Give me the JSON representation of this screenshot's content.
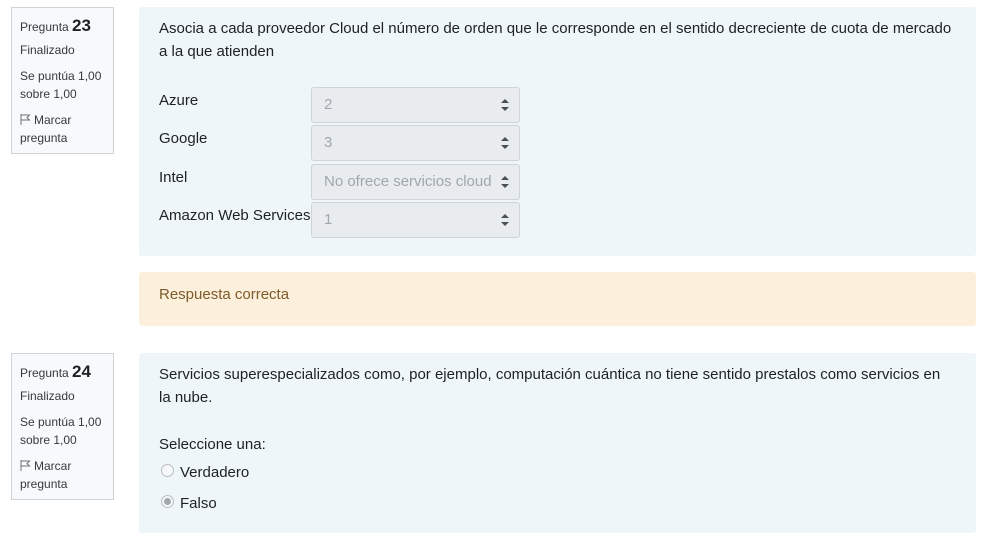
{
  "questions": [
    {
      "number_prefix": "Pregunta",
      "number": "23",
      "state": "Finalizado",
      "grade": "Se puntúa 1,00 sobre 1,00",
      "flag_label": "Marcar pregunta",
      "text": "Asocia a cada proveedor Cloud el número de orden que le corresponde en el sentido  decreciente de cuota de mercado a la que atienden",
      "matches": [
        {
          "label": "Azure",
          "value": "2"
        },
        {
          "label": "Google",
          "value": "3"
        },
        {
          "label": "Intel",
          "value": "No ofrece servicios cloud"
        },
        {
          "label": "Amazon Web Services",
          "value": "1"
        }
      ],
      "feedback": "Respuesta correcta"
    },
    {
      "number_prefix": "Pregunta",
      "number": "24",
      "state": "Finalizado",
      "grade": "Se puntúa 1,00 sobre 1,00",
      "flag_label": "Marcar pregunta",
      "text": "Servicios superespecializados como, por ejemplo, computación cuántica no tiene sentido prestalos como servicios en la nube.",
      "prompt": "Seleccione una:",
      "options": [
        {
          "label": "Verdadero",
          "checked": false
        },
        {
          "label": "Falso",
          "checked": true
        }
      ]
    }
  ],
  "icons": {
    "flag": "flag-icon",
    "select_arrows": "select-arrows-icon"
  },
  "colors": {
    "info_bg": "#f8f9fa",
    "formulation_bg": "#eef6f9",
    "feedback_bg": "#fcefdc",
    "feedback_text": "#7d5a29"
  }
}
